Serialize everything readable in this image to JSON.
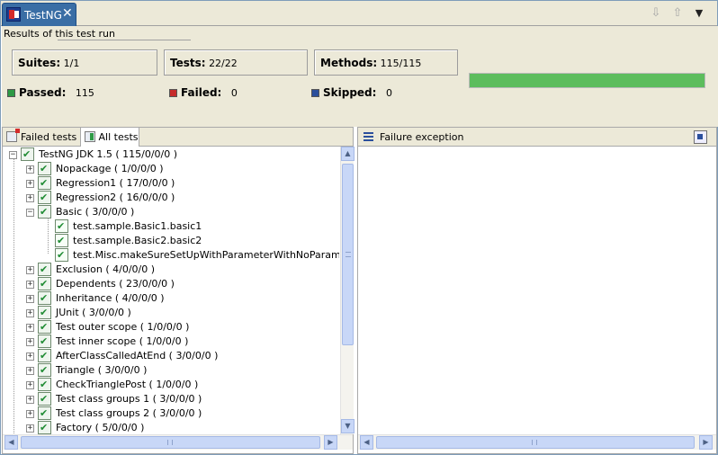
{
  "tab": {
    "title": "TestNG",
    "close_glyph": "✕"
  },
  "toolbar": {
    "next_failure_icon": "arrow-down-icon",
    "prev_failure_icon": "arrow-up-icon",
    "menu_icon": "view-menu-icon"
  },
  "summary": {
    "results_label": "Results of this test run",
    "suites_label": "Suites:",
    "suites_value": "1/1",
    "tests_label": "Tests:",
    "tests_value": "22/22",
    "methods_label": "Methods:",
    "methods_value": "115/115",
    "passed_label": "Passed:",
    "passed_value": "115",
    "failed_label": "Failed:",
    "failed_value": "0",
    "skipped_label": "Skipped:",
    "skipped_value": "0",
    "progress_fraction": 1.0,
    "progress_color": "#5dbd5d"
  },
  "left_tabs": {
    "failed": "Failed tests",
    "all": "All tests"
  },
  "tree": {
    "root": "TestNG JDK 1.5 ( 115/0/0/0 )",
    "items": [
      {
        "label": "Nopackage ( 1/0/0/0 )",
        "expanded": false
      },
      {
        "label": "Regression1 ( 17/0/0/0 )",
        "expanded": false
      },
      {
        "label": "Regression2 ( 16/0/0/0 )",
        "expanded": false
      },
      {
        "label": "Basic ( 3/0/0/0 )",
        "expanded": true
      },
      {
        "label": "Exclusion ( 4/0/0/0 )",
        "expanded": false
      },
      {
        "label": "Dependents ( 23/0/0/0 )",
        "expanded": false
      },
      {
        "label": "Inheritance ( 4/0/0/0 )",
        "expanded": false
      },
      {
        "label": "JUnit ( 3/0/0/0 )",
        "expanded": false
      },
      {
        "label": "Test outer scope ( 1/0/0/0 )",
        "expanded": false
      },
      {
        "label": "Test inner scope ( 1/0/0/0 )",
        "expanded": false
      },
      {
        "label": "AfterClassCalledAtEnd ( 3/0/0/0 )",
        "expanded": false
      },
      {
        "label": "Triangle ( 3/0/0/0 )",
        "expanded": false
      },
      {
        "label": "CheckTrianglePost ( 1/0/0/0 )",
        "expanded": false
      },
      {
        "label": "Test class groups 1 ( 3/0/0/0 )",
        "expanded": false
      },
      {
        "label": "Test class groups 2 ( 3/0/0/0 )",
        "expanded": false
      },
      {
        "label": "Factory ( 5/0/0/0 )",
        "expanded": false
      }
    ],
    "basic_children": [
      "test.sample.Basic1.basic1",
      "test.sample.Basic2.basic2",
      "test.Misc.makeSureSetUpWithParameterWithNoParametersFa"
    ]
  },
  "right": {
    "title": "Failure exception"
  },
  "scroll": {
    "up": "▲",
    "down": "▼",
    "left": "◀",
    "right": "▶"
  }
}
